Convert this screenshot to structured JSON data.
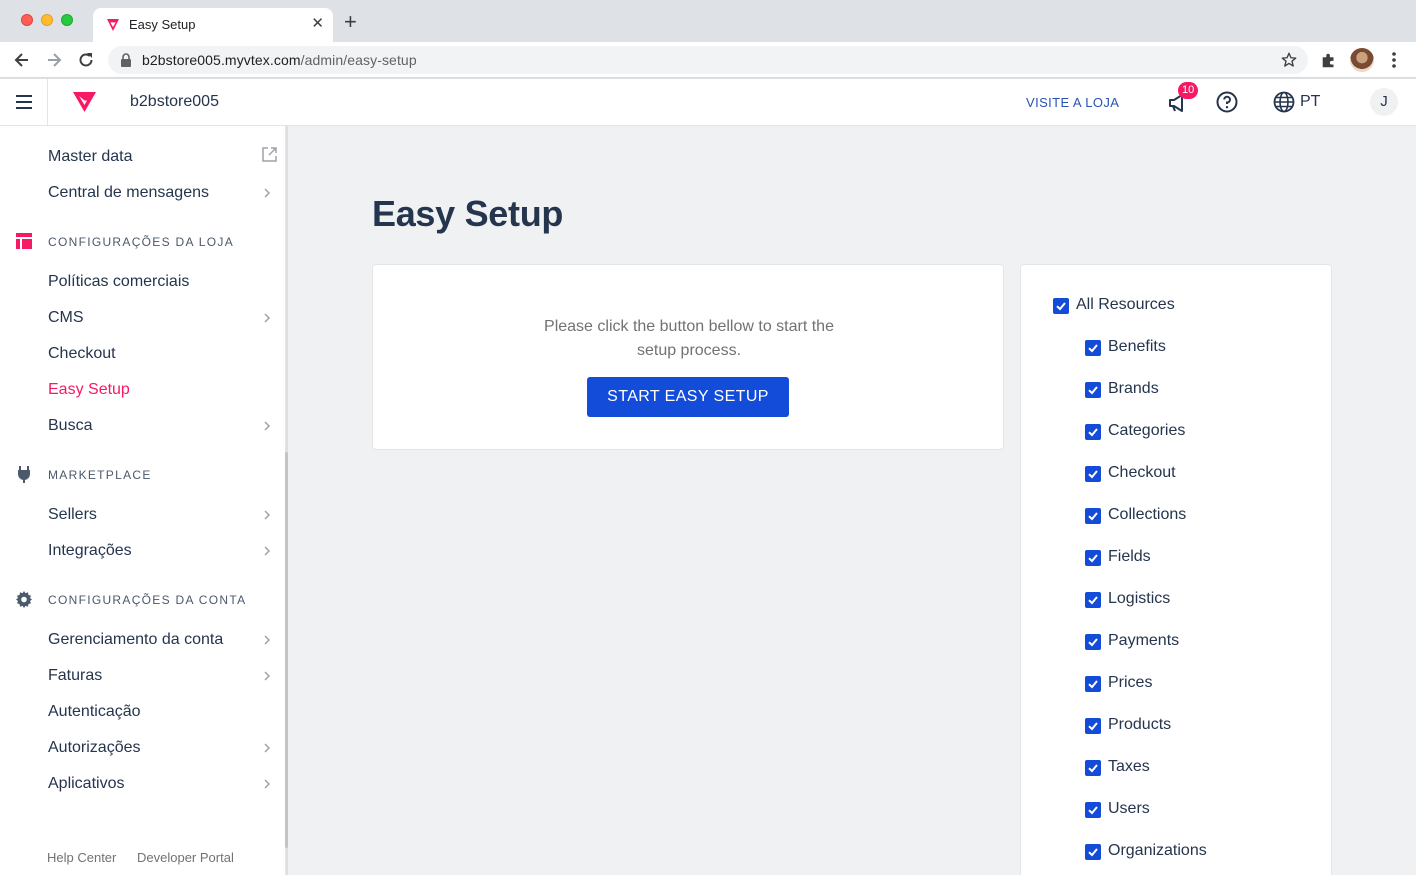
{
  "browser": {
    "tab_title": "Easy Setup",
    "url_host": "b2bstore005.myvtex.com",
    "url_path": "/admin/easy-setup"
  },
  "topbar": {
    "account": "b2bstore005",
    "visit_store": "VISITE A LOJA",
    "notifications_count": "10",
    "language": "PT",
    "user_initial": "J"
  },
  "sidebar": {
    "items_top": [
      {
        "label": "Master data"
      },
      {
        "label": "Central de mensagens"
      }
    ],
    "sections": [
      {
        "title": "CONFIGURAÇÕES DA LOJA",
        "items": [
          {
            "label": "Políticas comerciais"
          },
          {
            "label": "CMS"
          },
          {
            "label": "Checkout"
          },
          {
            "label": "Easy Setup"
          },
          {
            "label": "Busca"
          }
        ]
      },
      {
        "title": "MARKETPLACE",
        "items": [
          {
            "label": "Sellers"
          },
          {
            "label": "Integrações"
          }
        ]
      },
      {
        "title": "CONFIGURAÇÕES DA CONTA",
        "items": [
          {
            "label": "Gerenciamento da conta"
          },
          {
            "label": "Faturas"
          },
          {
            "label": "Autenticação"
          },
          {
            "label": "Autorizações"
          },
          {
            "label": "Aplicativos"
          }
        ]
      }
    ],
    "footer": {
      "help_center": "Help Center",
      "developer_portal": "Developer Portal"
    }
  },
  "main": {
    "title": "Easy Setup",
    "message_line1": "Please click the button bellow to start the",
    "message_line2": "setup process.",
    "start_button": "START EASY SETUP",
    "all_resources": "All Resources",
    "resources": [
      "Benefits",
      "Brands",
      "Categories",
      "Checkout",
      "Collections",
      "Fields",
      "Logistics",
      "Payments",
      "Prices",
      "Products",
      "Taxes",
      "Users",
      "Organizations"
    ]
  },
  "colors": {
    "brand_pink": "#f71963",
    "primary_blue": "#134cd8",
    "link_blue": "#2953b2",
    "text_dark": "#25354d"
  }
}
